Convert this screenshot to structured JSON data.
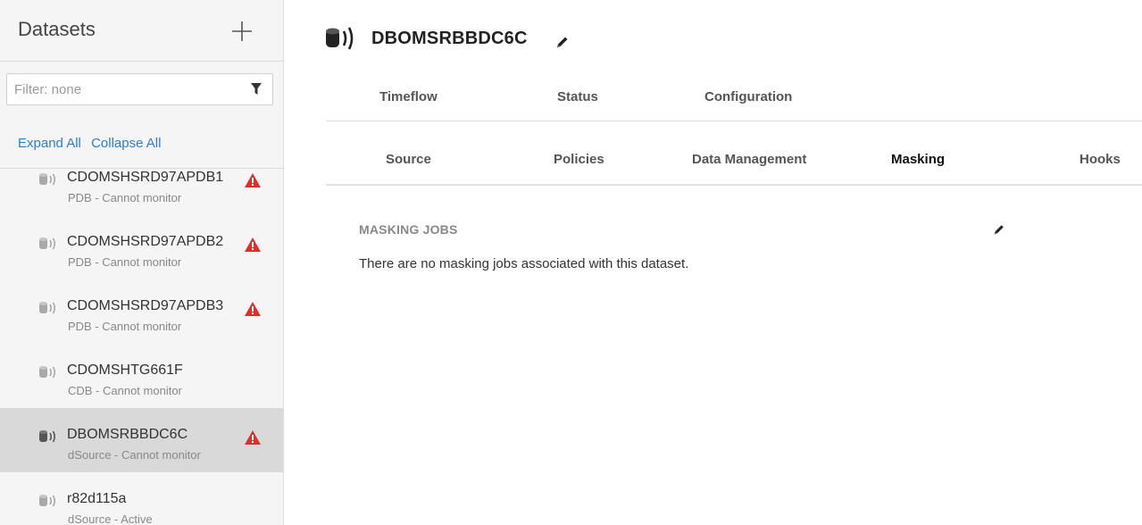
{
  "sidebar": {
    "title": "Datasets",
    "add_icon": "plus-icon",
    "filter_placeholder": "Filter: none",
    "filter_icon": "funnel-icon",
    "expand_all": "Expand All",
    "collapse_all": "Collapse All",
    "items": [
      {
        "name": "CDOMSHSRD97APDB1",
        "status": "PDB - Cannot monitor",
        "warning": true,
        "selected": false
      },
      {
        "name": "CDOMSHSRD97APDB2",
        "status": "PDB - Cannot monitor",
        "warning": true,
        "selected": false
      },
      {
        "name": "CDOMSHSRD97APDB3",
        "status": "PDB - Cannot monitor",
        "warning": true,
        "selected": false
      },
      {
        "name": "CDOMSHTG661F",
        "status": "CDB - Cannot monitor",
        "warning": false,
        "selected": false
      },
      {
        "name": "DBOMSRBBDC6C",
        "status": "dSource - Cannot monitor",
        "warning": true,
        "selected": true
      },
      {
        "name": "r82d115a",
        "status": "dSource - Active",
        "warning": false,
        "selected": false
      }
    ]
  },
  "main": {
    "title": "DBOMSRBBDC6C",
    "title_icon": "database-icon",
    "edit_icon": "pencil-icon",
    "tabs_primary": [
      "Timeflow",
      "Status",
      "Configuration"
    ],
    "tabs_secondary": [
      "Source",
      "Policies",
      "Data Management",
      "Masking",
      "Hooks"
    ],
    "active_tab": "Masking",
    "section": {
      "title": "MASKING JOBS",
      "message": "There are no masking jobs associated with this dataset."
    }
  },
  "colors": {
    "link": "#2a7fd4",
    "warning": "#d9302c",
    "selected_row": "#d9d9d9",
    "sidebar_bg": "#f5f5f5"
  }
}
